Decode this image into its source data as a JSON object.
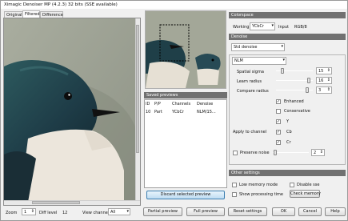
{
  "window": {
    "title": "Ximagic Denoiser MP (4.2.3) 32 bits (SSE available)"
  },
  "tabs": [
    {
      "label": "Original"
    },
    {
      "label": "Filtered"
    },
    {
      "label": "Difference"
    }
  ],
  "bottom": {
    "zoom_label": "Zoom",
    "zoom_value": "1",
    "diff_label": "Diff level",
    "diff_value": "12",
    "channel_label": "View channel",
    "channel_value": "All"
  },
  "saved_previews": {
    "title": "Saved previews",
    "columns": [
      "ID",
      "P/P",
      "Channels",
      "Denoise"
    ],
    "rows": [
      [
        "10",
        "Part",
        "YCbCr",
        "NLM/15..."
      ]
    ],
    "discard_label": "Discard selected preview"
  },
  "colorspace": {
    "title": "Colorspace",
    "working_label": "Working",
    "working_value": "YCbCr",
    "input_label": "Input",
    "input_value": "RGB/8"
  },
  "denoise": {
    "title": "Denoise",
    "mode": "Std denoise",
    "algorithm": "NLM",
    "spatial_sigma_label": "Spatial sigma",
    "spatial_sigma": "15",
    "learn_radius_label": "Learn radius",
    "learn_radius": "16",
    "compare_radius_label": "Compare radius",
    "compare_radius": "3",
    "enhanced_label": "Enhanced",
    "enhanced": true,
    "conservative_label": "Conservative",
    "conservative": false,
    "apply_label": "Apply to channel",
    "ch_y": "Y",
    "ch_cb": "Cb",
    "ch_cr": "Cr",
    "preserve_label": "Preserve noise",
    "preserve_value": "2",
    "spatial_sigma_pos": 0.15,
    "learn_radius_pos": 0.92,
    "compare_radius_pos": 0.88,
    "preserve_pos": 0.02
  },
  "other": {
    "title": "Other settings",
    "low_memory": "Low memory mode",
    "disable_sse": "Disable sse",
    "show_time": "Show processing time",
    "check_memory": "Check memory"
  },
  "buttons": {
    "partial": "Partial preview",
    "full": "Full preview",
    "reset": "Reset settings",
    "ok": "OK",
    "cancel": "Cancel",
    "help": "Help"
  }
}
